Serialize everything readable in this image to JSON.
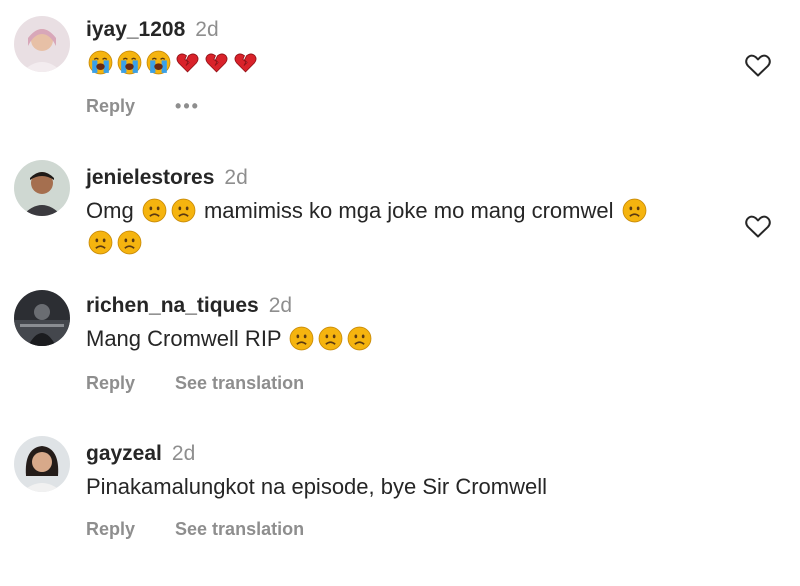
{
  "comments": [
    {
      "username": "iyay_1208",
      "time": "2d",
      "text_before": "",
      "text_mid": "",
      "text_line2": "",
      "reply_label": "Reply",
      "more_label": "•••",
      "emoji_sequence": [
        "crying-face",
        "crying-face",
        "crying-face",
        "broken-heart",
        "broken-heart",
        "broken-heart"
      ]
    },
    {
      "username": "jenielestores",
      "time": "2d",
      "text_before": "Omg",
      "text_mid": "mamimiss ko mga joke mo mang cromwel",
      "emoji_sequence": [
        "sad-face",
        "sad-face",
        "sad-face",
        "sad-face",
        "sad-face"
      ]
    },
    {
      "username": "richen_na_tiques",
      "time": "2d",
      "text_before": "Mang Cromwell RIP",
      "reply_label": "Reply",
      "translate_label": "See translation",
      "emoji_sequence": [
        "sad-face",
        "sad-face",
        "sad-face"
      ]
    },
    {
      "username": "gayzeal",
      "time": "2d",
      "text_before": "Pinakamalungkot na episode, bye Sir Cromwell",
      "reply_label": "Reply",
      "translate_label": "See translation"
    }
  ],
  "icons": {
    "like": "heart-outline-icon",
    "crying_face": "loudly-crying-face-emoji",
    "sad_face": "sad-face-emoji",
    "broken_heart": "broken-heart-emoji"
  },
  "colors": {
    "text": "#262626",
    "muted": "#8e8e8e",
    "emoji_yellow": "#f5b40f",
    "tears": "#3aa0e8",
    "heart_red": "#d9222a"
  }
}
